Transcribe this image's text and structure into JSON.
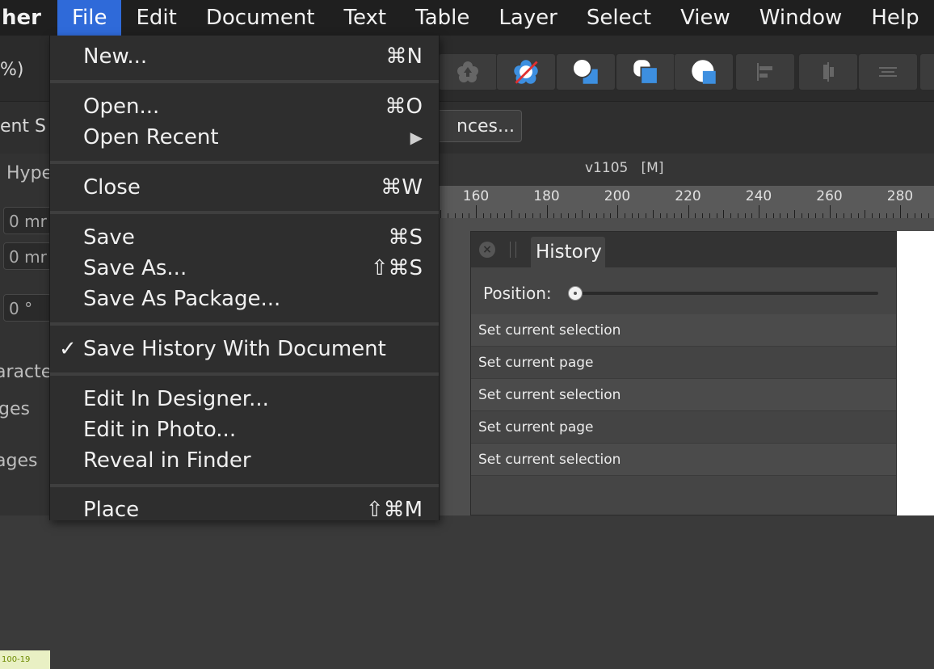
{
  "menubar": {
    "items": [
      "her",
      "File",
      "Edit",
      "Document",
      "Text",
      "Table",
      "Layer",
      "Select",
      "View",
      "Window",
      "Help"
    ],
    "active": "File"
  },
  "toolbar": {
    "zoom_text": "%)",
    "buttons": [
      "flower-up-icon",
      "flower-cross-icon",
      "circle-square-icon",
      "rounded-square-icon",
      "pie-square-icon",
      "align-left-icon",
      "align-center-icon",
      "align-distribute-icon"
    ],
    "accent": "#3d8fe0"
  },
  "contextbar": {
    "left_text": "nent S",
    "prefs_label": "nces..."
  },
  "document": {
    "title": "v1105   [M]"
  },
  "left_panel": {
    "hype_label": "Hype",
    "field1": "0 mr",
    "field2": "0 mr",
    "field3": "0 °",
    "characters_label": "aracte",
    "pages_label": "ges",
    "images_label": "ages",
    "thumb_label": "100-19"
  },
  "ruler": {
    "labels": [
      "160",
      "180",
      "200",
      "220",
      "240",
      "260",
      "280"
    ]
  },
  "file_menu": {
    "new": {
      "label": "New...",
      "shortcut": "⌘N"
    },
    "open": {
      "label": "Open...",
      "shortcut": "⌘O"
    },
    "open_recent": {
      "label": "Open Recent",
      "submenu_arrow": "▶"
    },
    "close": {
      "label": "Close",
      "shortcut": "⌘W"
    },
    "save": {
      "label": "Save",
      "shortcut": "⌘S"
    },
    "save_as": {
      "label": "Save As...",
      "shortcut": "⇧⌘S"
    },
    "save_as_package": {
      "label": "Save As Package..."
    },
    "save_history": {
      "label": "Save History With Document",
      "checkmark": "✓",
      "checked": true
    },
    "edit_in_designer": {
      "label": "Edit In Designer..."
    },
    "edit_in_photo": {
      "label": "Edit in Photo..."
    },
    "reveal_in_finder": {
      "label": "Reveal in Finder"
    },
    "place": {
      "label": "Place",
      "shortcut": "⇧⌘M"
    }
  },
  "history_panel": {
    "tab_title": "History",
    "position_label": "Position:",
    "position_value": 0,
    "items": [
      "Set current selection",
      "Set current page",
      "Set current selection",
      "Set current page",
      "Set current selection"
    ]
  }
}
